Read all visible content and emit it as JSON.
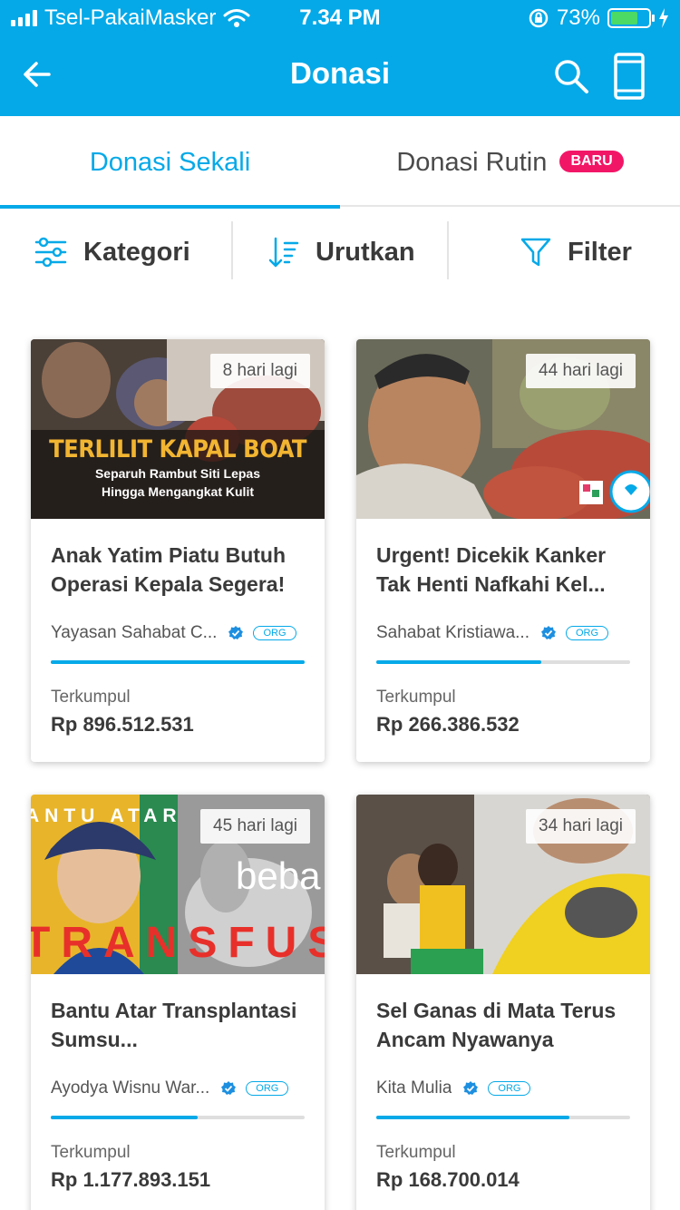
{
  "status_bar": {
    "carrier": "Tsel-PakaiMasker",
    "time": "7.34 PM",
    "battery_percent": "73%",
    "battery_level": 0.73
  },
  "app_bar": {
    "title": "Donasi",
    "icons": [
      "back-arrow-icon",
      "search-icon",
      "page-icon"
    ]
  },
  "tabs": [
    {
      "label": "Donasi Sekali",
      "active": true
    },
    {
      "label": "Donasi Rutin",
      "badge": "BARU",
      "active": false
    }
  ],
  "filter_bar": {
    "kategori": "Kategori",
    "urutkan": "Urutkan",
    "filter": "Filter"
  },
  "colors": {
    "brand": "#05a9e8",
    "badge_new": "#f21667"
  },
  "campaigns": [
    {
      "days_left": "8 hari lagi",
      "image_text": [
        "TERLILIT KAPAL BOAT",
        "Separuh Rambut Siti Lepas",
        "Hingga Mengangkat Kulit"
      ],
      "title": "Anak Yatim Piatu Butuh Operasi Kepala Segera!",
      "organizer": "Yayasan Sahabat C...",
      "org_tag": "ORG",
      "progress": 1.0,
      "collected_label": "Terkumpul",
      "collected_amount": "Rp 896.512.531"
    },
    {
      "days_left": "44 hari lagi",
      "image_text": [],
      "title": "Urgent! Dicekik Kanker Tak Henti Nafkahi Kel...",
      "organizer": "Sahabat Kristiawa...",
      "org_tag": "ORG",
      "progress": 0.65,
      "collected_label": "Terkumpul",
      "collected_amount": "Rp 266.386.532"
    },
    {
      "days_left": "45 hari lagi",
      "image_text": [
        "ANTU ATAR",
        "beba",
        "TRANSFUS"
      ],
      "title": "Bantu Atar Transplantasi Sumsu...",
      "organizer": "Ayodya Wisnu War...",
      "org_tag": "ORG",
      "progress": 0.58,
      "collected_label": "Terkumpul",
      "collected_amount": "Rp 1.177.893.151"
    },
    {
      "days_left": "34 hari lagi",
      "image_text": [],
      "title": "Sel Ganas di Mata Terus Ancam Nyawanya",
      "organizer": "Kita Mulia",
      "org_tag": "ORG",
      "progress": 0.76,
      "collected_label": "Terkumpul",
      "collected_amount": "Rp 168.700.014"
    }
  ]
}
